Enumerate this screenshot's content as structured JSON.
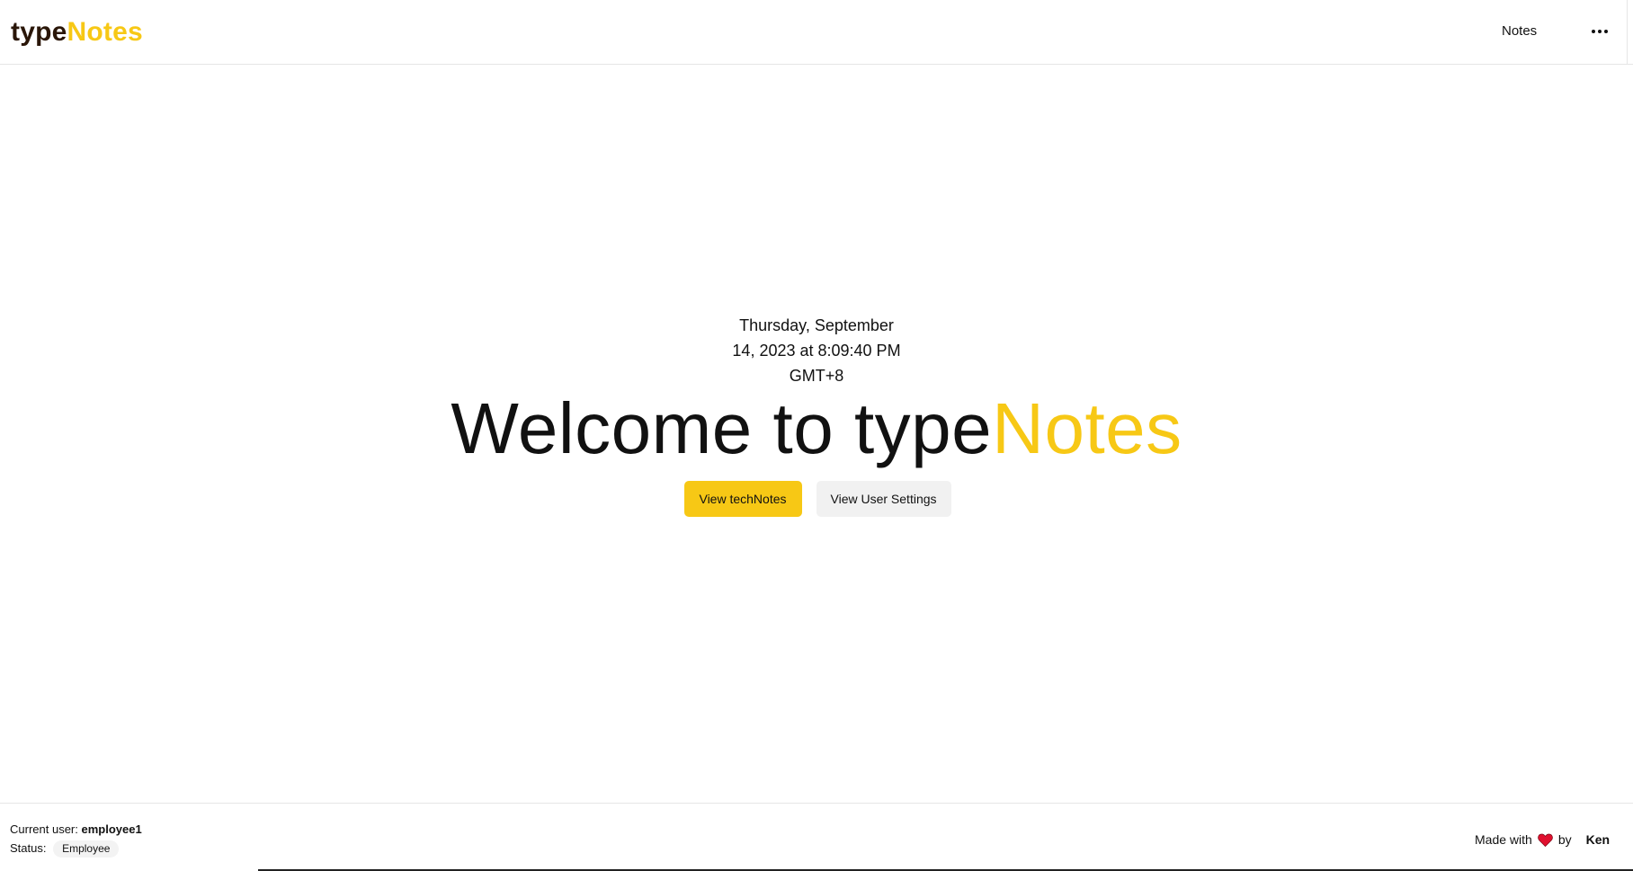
{
  "header": {
    "logo": {
      "part_a": "type",
      "part_b": "Notes"
    },
    "nav_notes_label": "Notes",
    "more_icon": "ellipsis-icon"
  },
  "hero": {
    "datetime_line1": "Thursday, September",
    "datetime_line2": "14, 2023 at 8:09:40 PM",
    "datetime_line3": "GMT+8",
    "welcome_prefix": "Welcome to type",
    "welcome_brand": "Notes",
    "primary_button_label": "View techNotes",
    "secondary_button_label": "View User Settings"
  },
  "footer": {
    "current_user_label": "Current user:",
    "current_user_value": "employee1",
    "status_label": "Status:",
    "status_value": "Employee",
    "made_with_label": "Made with",
    "heart_icon": "heart-icon",
    "by_label": "by",
    "author": "Ken"
  },
  "colors": {
    "accent": "#f7c815",
    "logo_dark": "#2a1608",
    "heart": "#e0102e"
  }
}
